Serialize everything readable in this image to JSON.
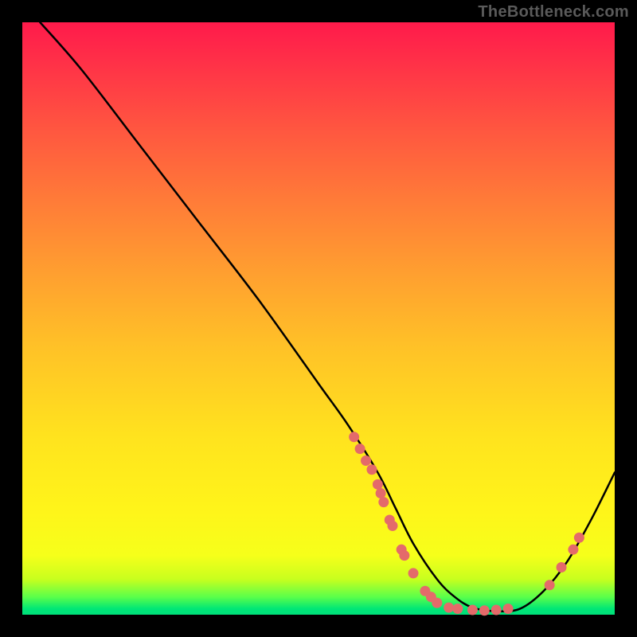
{
  "watermark": "TheBottleneck.com",
  "chart_data": {
    "type": "line",
    "title": "",
    "xlabel": "",
    "ylabel": "",
    "xlim": [
      0,
      100
    ],
    "ylim": [
      0,
      100
    ],
    "series": [
      {
        "name": "curve",
        "x": [
          3,
          10,
          20,
          30,
          40,
          50,
          55,
          60,
          63,
          66,
          70,
          73,
          76,
          80,
          84,
          88,
          92,
          96,
          100
        ],
        "y": [
          100,
          92,
          79,
          66,
          53,
          39,
          32,
          24,
          18,
          12,
          6,
          3,
          1.2,
          0.6,
          1.0,
          4,
          9,
          16,
          24
        ]
      }
    ],
    "markers": [
      {
        "x": 56,
        "y": 30
      },
      {
        "x": 57,
        "y": 28
      },
      {
        "x": 58,
        "y": 26
      },
      {
        "x": 59,
        "y": 24.5
      },
      {
        "x": 60,
        "y": 22
      },
      {
        "x": 60.5,
        "y": 20.5
      },
      {
        "x": 61,
        "y": 19
      },
      {
        "x": 62,
        "y": 16
      },
      {
        "x": 62.5,
        "y": 15
      },
      {
        "x": 64,
        "y": 11
      },
      {
        "x": 64.5,
        "y": 10
      },
      {
        "x": 66,
        "y": 7
      },
      {
        "x": 68,
        "y": 4
      },
      {
        "x": 69,
        "y": 3
      },
      {
        "x": 70,
        "y": 2
      },
      {
        "x": 72,
        "y": 1.2
      },
      {
        "x": 73.5,
        "y": 1
      },
      {
        "x": 76,
        "y": 0.8
      },
      {
        "x": 78,
        "y": 0.7
      },
      {
        "x": 80,
        "y": 0.8
      },
      {
        "x": 82,
        "y": 1
      },
      {
        "x": 89,
        "y": 5
      },
      {
        "x": 91,
        "y": 8
      },
      {
        "x": 93,
        "y": 11
      },
      {
        "x": 94,
        "y": 13
      }
    ],
    "colors": {
      "curve": "#000000",
      "markers": "#e46a6a"
    }
  }
}
